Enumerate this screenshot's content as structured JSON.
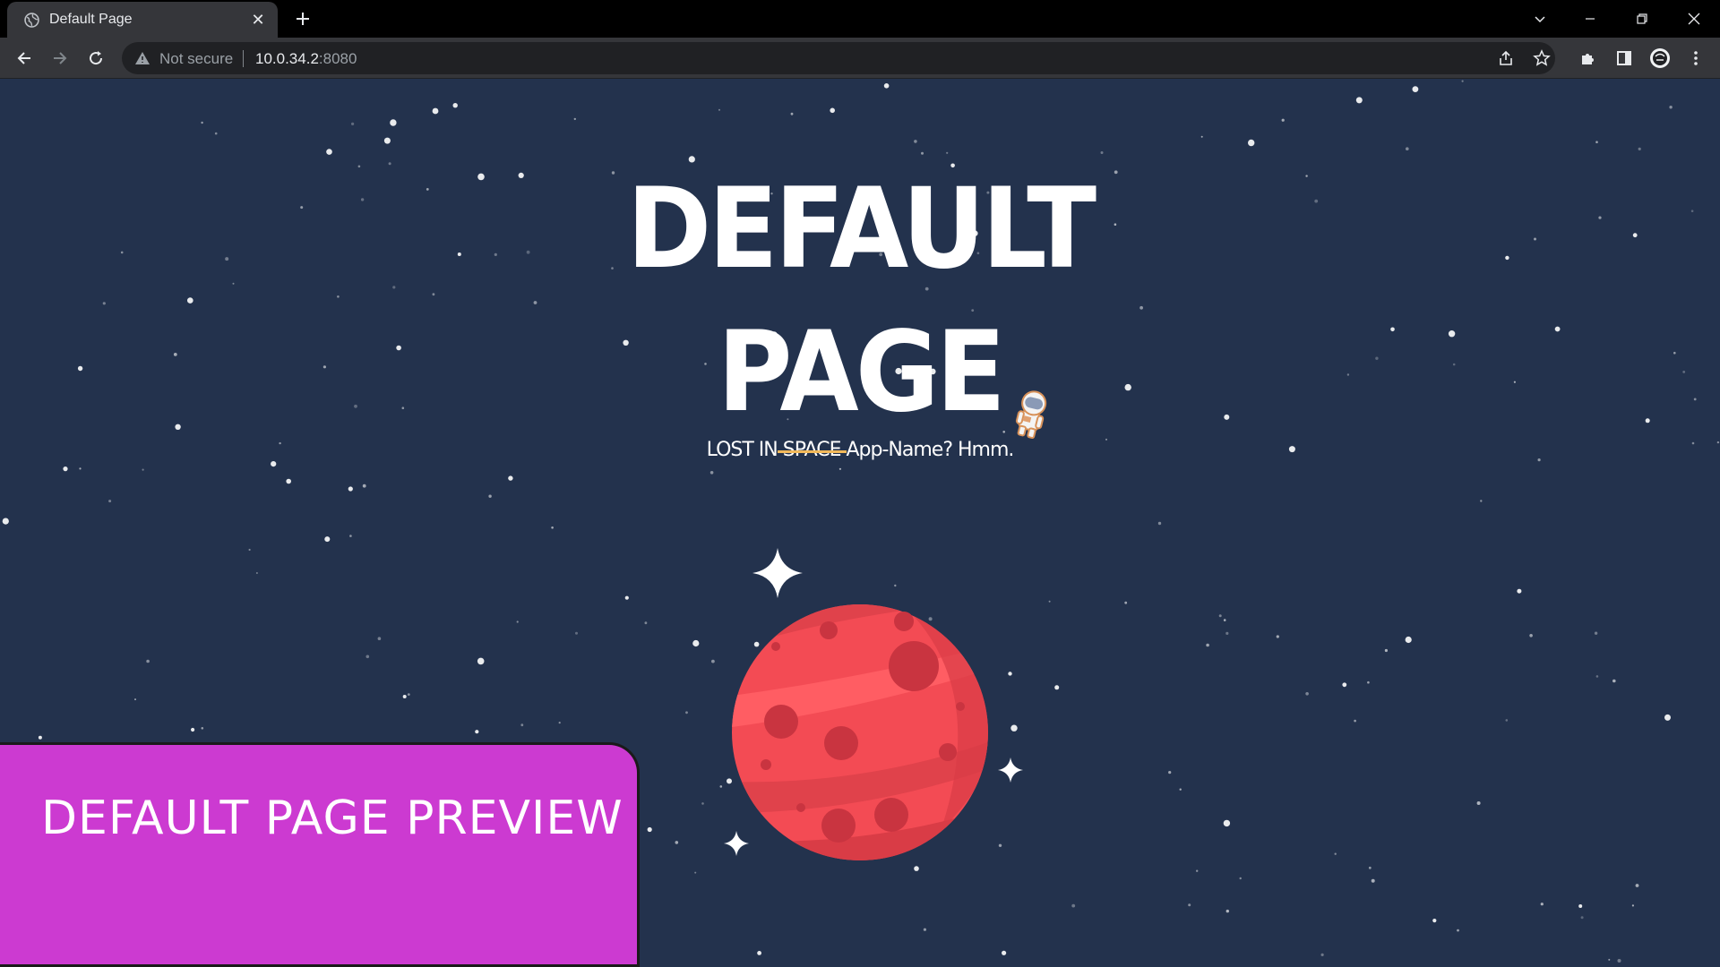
{
  "browser": {
    "tab": {
      "title": "Default Page",
      "close_icon": "close-icon"
    },
    "new_tab_icon": "plus-icon",
    "window_controls": [
      "tab-search-icon",
      "minimize-icon",
      "restore-icon",
      "close-window-icon"
    ],
    "address_bar": {
      "security_text": "Not secure",
      "host": "10.0.34.2",
      "port": ":8080"
    },
    "toolbar_icons": [
      "back-icon",
      "forward-icon",
      "reload-icon",
      "share-icon",
      "bookmark-star-icon",
      "extensions-icon",
      "side-panel-icon",
      "profile-avatar",
      "menu-icon"
    ]
  },
  "page": {
    "headline_line1": "DEFAULT",
    "headline_line2": "PAGE",
    "tagline_prefix": "LOST IN",
    "tagline_struck": "SPACE",
    "tagline_suffix": "App-Name? Hmm.",
    "illustration": "red-planet",
    "mascot": "astronaut-icon"
  },
  "overlay": {
    "label": "DEFAULT PAGE PREVIEW"
  },
  "colors": {
    "background": "#23324d",
    "planet": "#f34b54",
    "strike": "#f2b95a",
    "overlay": "#cc3ad1"
  }
}
